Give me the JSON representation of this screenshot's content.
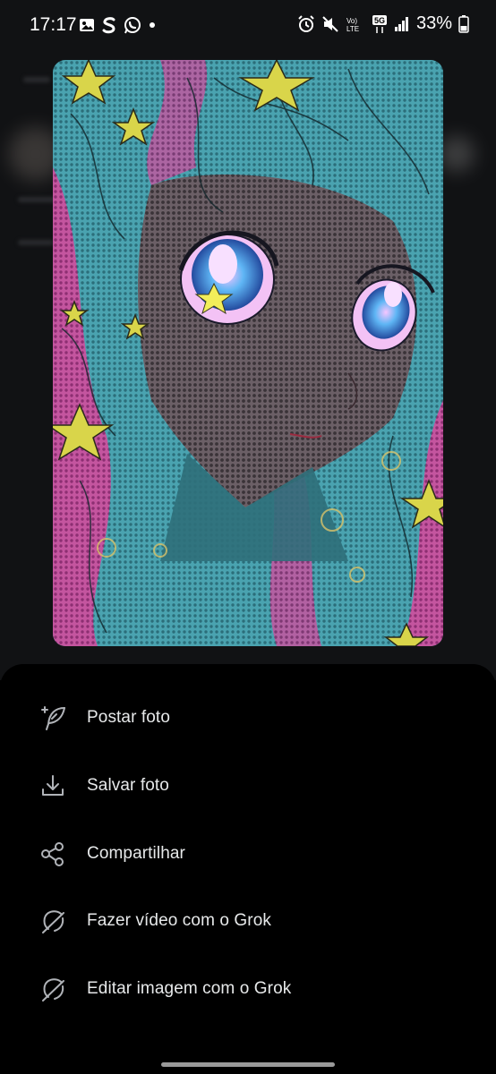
{
  "status_bar": {
    "time": "17:17",
    "battery": "33%",
    "icons_left": [
      "gallery-icon",
      "s-app-icon",
      "whatsapp-icon",
      "dot-icon"
    ],
    "icons_right": [
      "alarm-icon",
      "mute-icon",
      "volte-icon",
      "5g-icon",
      "signal-icon",
      "battery-icon"
    ]
  },
  "photo": {
    "description_icon": "anime-illustration-image"
  },
  "menu": {
    "items": [
      {
        "label": "Postar foto",
        "icon": "feather-plus-icon"
      },
      {
        "label": "Salvar foto",
        "icon": "download-icon"
      },
      {
        "label": "Compartilhar",
        "icon": "share-icon"
      },
      {
        "label": "Fazer vídeo com o Grok",
        "icon": "grok-icon"
      },
      {
        "label": "Editar imagem com o Grok",
        "icon": "grok-icon"
      }
    ]
  },
  "colors": {
    "background": "#000000",
    "text": "#e7e9ea",
    "icon": "#b0b3b8"
  }
}
